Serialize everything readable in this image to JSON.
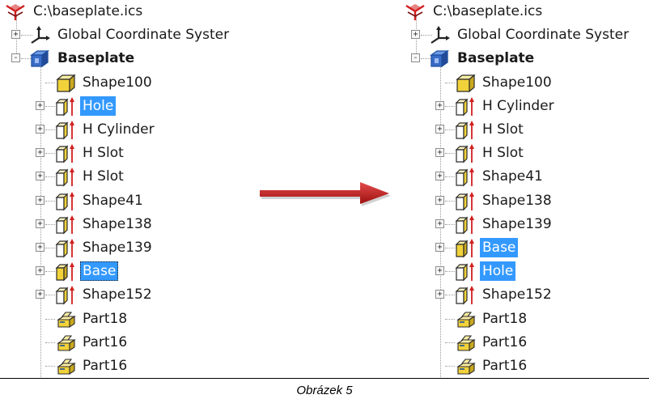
{
  "caption": "Obrázek 5",
  "colors": {
    "selection": "#3399ff",
    "shape_yellow": "#f2d23a",
    "shape_outline": "#2b2b2b",
    "axis_red": "#d21f1f",
    "arrow_red": "#c11a1a",
    "part_blue": "#1e4fa0"
  },
  "left_tree": {
    "file": "C:\\baseplate.ics",
    "coord": "Global Coordinate Syster",
    "assembly": "Baseplate",
    "items": [
      {
        "label": "Shape100",
        "icon": "solid-box-icon",
        "expandable": false,
        "selected": false
      },
      {
        "label": "Hole",
        "icon": "shape-axis-icon",
        "expandable": true,
        "selected": true
      },
      {
        "label": "H Cylinder",
        "icon": "shape-axis-icon",
        "expandable": true,
        "selected": false
      },
      {
        "label": "H Slot",
        "icon": "shape-axis-icon",
        "expandable": true,
        "selected": false
      },
      {
        "label": "H Slot",
        "icon": "shape-axis-icon",
        "expandable": true,
        "selected": false
      },
      {
        "label": "Shape41",
        "icon": "shape-axis-icon",
        "expandable": true,
        "selected": false
      },
      {
        "label": "Shape138",
        "icon": "shape-axis-icon",
        "expandable": true,
        "selected": false
      },
      {
        "label": "Shape139",
        "icon": "shape-axis-icon",
        "expandable": true,
        "selected": false
      },
      {
        "label": "Base",
        "icon": "shape-axis-solid-icon",
        "expandable": true,
        "selected": true,
        "focused": true
      },
      {
        "label": "Shape152",
        "icon": "shape-axis-icon",
        "expandable": true,
        "selected": false
      },
      {
        "label": "Part18",
        "icon": "part-icon",
        "expandable": false,
        "selected": false
      },
      {
        "label": "Part16",
        "icon": "part-icon",
        "expandable": false,
        "selected": false
      },
      {
        "label": "Part16",
        "icon": "part-icon",
        "expandable": false,
        "selected": false
      }
    ]
  },
  "right_tree": {
    "file": "C:\\baseplate.ics",
    "coord": "Global Coordinate Syster",
    "assembly": "Baseplate",
    "items": [
      {
        "label": "Shape100",
        "icon": "solid-box-icon",
        "expandable": false,
        "selected": false
      },
      {
        "label": "H Cylinder",
        "icon": "shape-axis-icon",
        "expandable": true,
        "selected": false
      },
      {
        "label": "H Slot",
        "icon": "shape-axis-icon",
        "expandable": true,
        "selected": false
      },
      {
        "label": "H Slot",
        "icon": "shape-axis-icon",
        "expandable": true,
        "selected": false
      },
      {
        "label": "Shape41",
        "icon": "shape-axis-icon",
        "expandable": true,
        "selected": false
      },
      {
        "label": "Shape138",
        "icon": "shape-axis-icon",
        "expandable": true,
        "selected": false
      },
      {
        "label": "Shape139",
        "icon": "shape-axis-icon",
        "expandable": true,
        "selected": false
      },
      {
        "label": "Base",
        "icon": "shape-axis-solid-icon",
        "expandable": true,
        "selected": true
      },
      {
        "label": "Hole",
        "icon": "shape-axis-icon",
        "expandable": true,
        "selected": true
      },
      {
        "label": "Shape152",
        "icon": "shape-axis-icon",
        "expandable": true,
        "selected": false
      },
      {
        "label": "Part18",
        "icon": "part-icon",
        "expandable": false,
        "selected": false
      },
      {
        "label": "Part16",
        "icon": "part-icon",
        "expandable": false,
        "selected": false
      },
      {
        "label": "Part16",
        "icon": "part-icon",
        "expandable": false,
        "selected": false
      }
    ]
  }
}
